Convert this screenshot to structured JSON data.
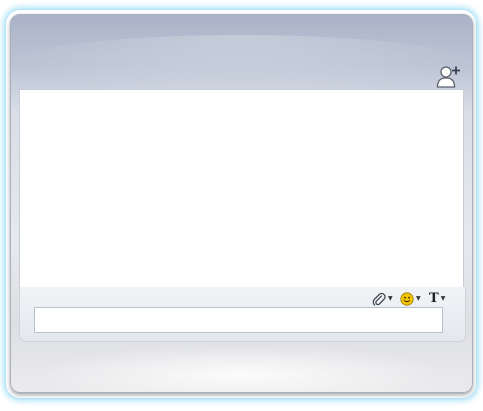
{
  "header": {
    "add_contact_icon": "add-contact-icon"
  },
  "chat": {
    "messages": []
  },
  "compose": {
    "tools": [
      {
        "name": "attach",
        "icon": "paperclip-icon",
        "has_dropdown": true
      },
      {
        "name": "emoticons",
        "icon": "smiley-icon",
        "has_dropdown": true
      },
      {
        "name": "font",
        "icon": "font-icon",
        "label": "T",
        "has_dropdown": true
      }
    ],
    "message_value": "",
    "message_placeholder": ""
  },
  "colors": {
    "glow": "#3cbef0",
    "window_top": "#aab3c7",
    "window_bottom": "#ebebed",
    "chat_background": "#ffffff",
    "smiley": "#f2c300"
  }
}
